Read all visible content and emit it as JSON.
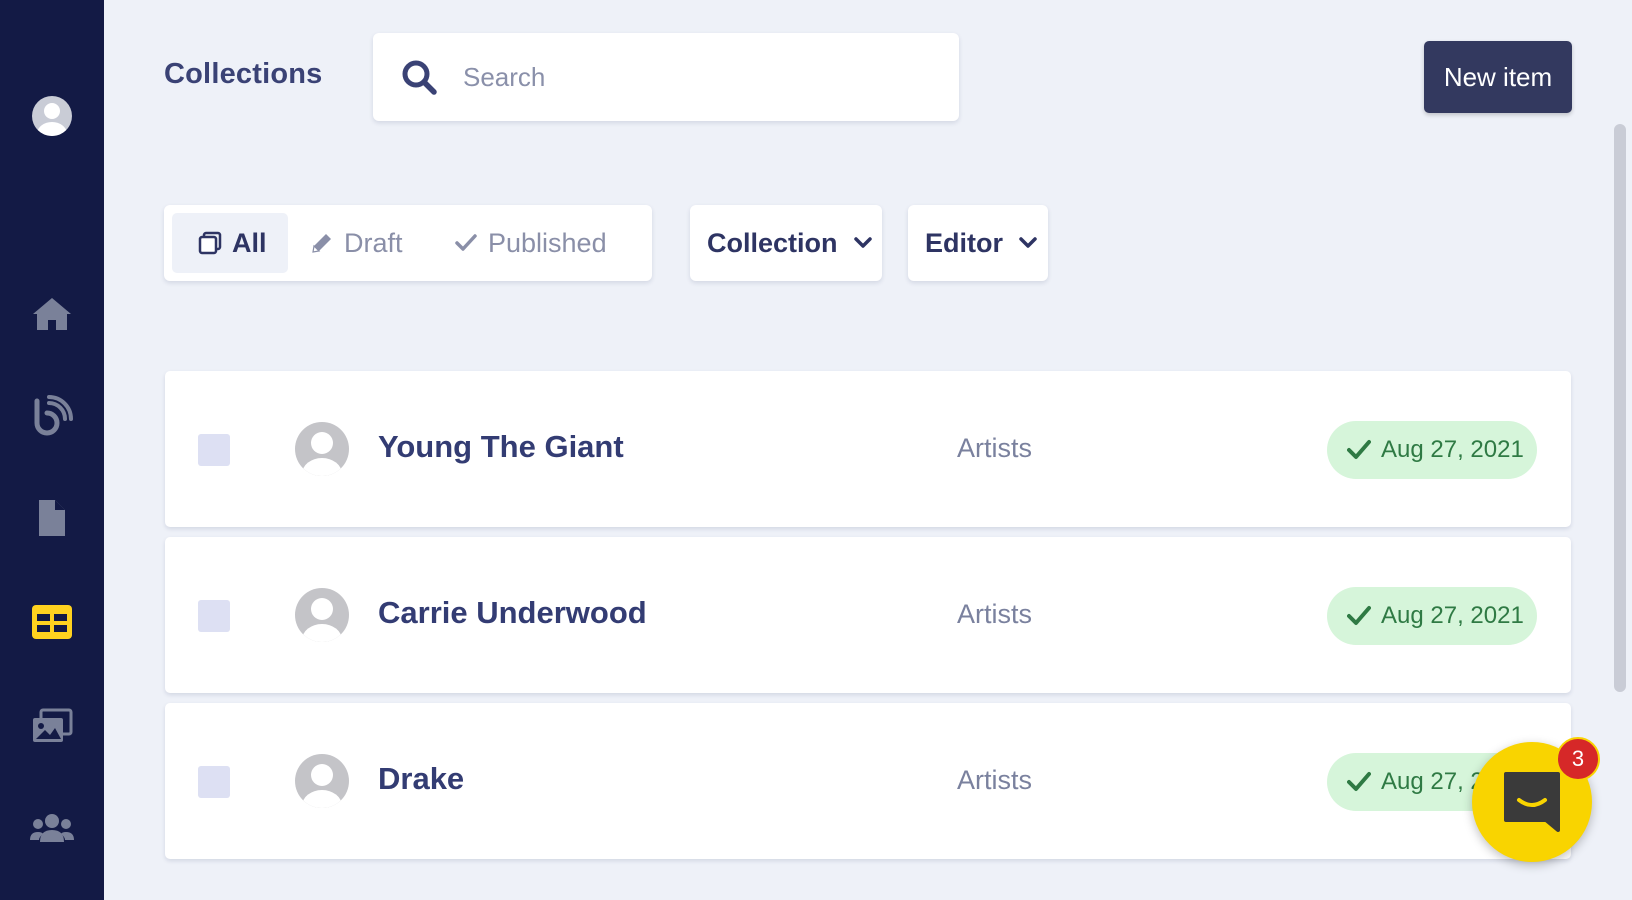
{
  "sidebar": {
    "items": [
      {
        "name": "profile-avatar",
        "icon": "user-icon"
      },
      {
        "name": "sidebar-item-home",
        "icon": "home-icon"
      },
      {
        "name": "sidebar-item-blog",
        "icon": "blog-feed-icon"
      },
      {
        "name": "sidebar-item-pages",
        "icon": "document-icon"
      },
      {
        "name": "sidebar-item-collections",
        "icon": "table-icon",
        "active": true
      },
      {
        "name": "sidebar-item-media",
        "icon": "images-icon"
      },
      {
        "name": "sidebar-item-team",
        "icon": "users-icon"
      }
    ],
    "accent": "#ffd21f"
  },
  "header": {
    "title": "Collections",
    "search_placeholder": "Search",
    "new_item_label": "New item"
  },
  "filters": {
    "status_tabs": [
      {
        "label": "All",
        "icon": "copy-icon",
        "active": true
      },
      {
        "label": "Draft",
        "icon": "pencil-icon",
        "active": false
      },
      {
        "label": "Published",
        "icon": "check-icon",
        "active": false
      }
    ],
    "collection_dropdown": "Collection",
    "editor_dropdown": "Editor"
  },
  "items": [
    {
      "name": "Young The Giant",
      "collection": "Artists",
      "date": "Aug 27, 2021",
      "status": "published"
    },
    {
      "name": "Carrie Underwood",
      "collection": "Artists",
      "date": "Aug 27, 2021",
      "status": "published"
    },
    {
      "name": "Drake",
      "collection": "Artists",
      "date": "Aug 27, 2021",
      "status": "published"
    }
  ],
  "chat": {
    "badge_count": "3",
    "icon": "chat-smile-icon"
  }
}
